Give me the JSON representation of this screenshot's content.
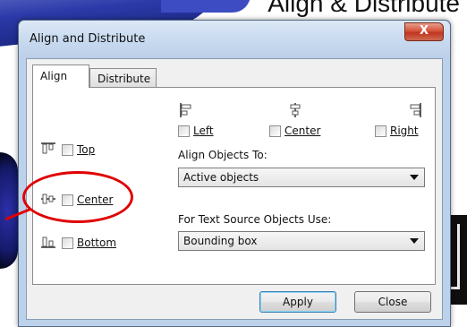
{
  "slide": {
    "title": "Align & Distribute"
  },
  "dialog": {
    "title": "Align and Distribute",
    "close_glyph": "X",
    "tabs": [
      {
        "label": "Align",
        "active": true
      },
      {
        "label": "Distribute",
        "active": false
      }
    ],
    "horizontal": {
      "left_label": "Left",
      "center_label": "Center",
      "right_label": "Right"
    },
    "vertical": {
      "top_label": "Top",
      "center_label": "Center",
      "bottom_label": "Bottom"
    },
    "align_objects_to": {
      "label": "Align Objects To:",
      "value": "Active objects"
    },
    "text_source": {
      "label": "For Text Source Objects Use:",
      "value": "Bounding box"
    },
    "buttons": {
      "apply": "Apply",
      "close": "Close"
    }
  },
  "annotation_color": "#e00000"
}
